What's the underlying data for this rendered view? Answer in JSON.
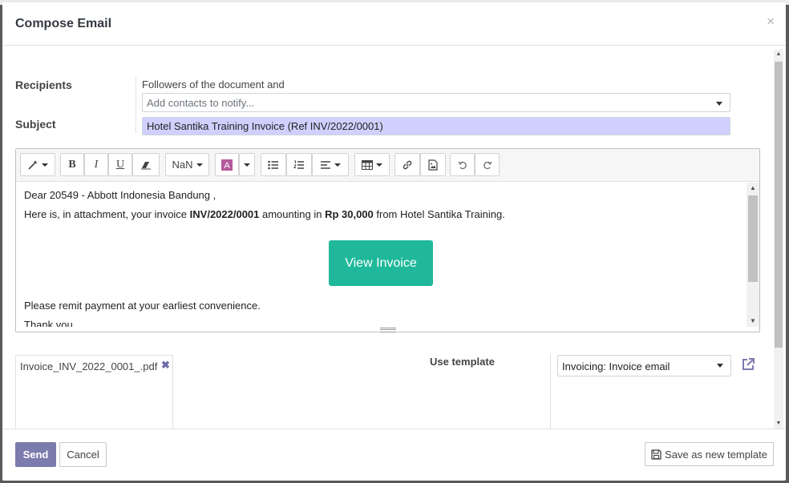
{
  "dialog": {
    "title": "Compose Email",
    "close_symbol": "×"
  },
  "form": {
    "recipients_label": "Recipients",
    "followers_text": "Followers of the document and",
    "contacts_placeholder": "Add contacts to notify...",
    "subject_label": "Subject",
    "subject_value": "Hotel Santika Training Invoice (Ref INV/2022/0001)"
  },
  "toolbar": {
    "font_size": "NaN",
    "icons": [
      "magic-wand-icon",
      "bold-icon",
      "italic-icon",
      "underline-icon",
      "eraser-icon",
      "font-size-dropdown",
      "font-color-icon",
      "color-dropdown",
      "unordered-list-icon",
      "ordered-list-icon",
      "align-icon",
      "table-icon",
      "link-icon",
      "image-icon",
      "undo-icon",
      "redo-icon"
    ],
    "bold": "B",
    "italic": "I",
    "underline": "U"
  },
  "body": {
    "greeting": "Dear 20549 - Abbott Indonesia Bandung ,",
    "line_prefix": "Here is, in attachment, your invoice ",
    "invoice_ref": "INV/2022/0001",
    "line_mid": " amounting in ",
    "amount": "Rp 30,000",
    "line_suffix": " from Hotel Santika Training.",
    "button_label": "View Invoice",
    "remit": "Please remit payment at your earliest convenience.",
    "closing": "Thank you,"
  },
  "attachments": [
    {
      "filename": "Invoice_INV_2022_0001_.pdf",
      "remove": "✖"
    }
  ],
  "template": {
    "label": "Use template",
    "selected": "Invoicing: Invoice email"
  },
  "footer": {
    "send_label": "Send",
    "cancel_label": "Cancel",
    "save_template_label": "Save as new template"
  },
  "colors": {
    "primary": "#7c7bad",
    "view_button": "#1fb89a",
    "subject_bg": "#d0d0ff"
  }
}
